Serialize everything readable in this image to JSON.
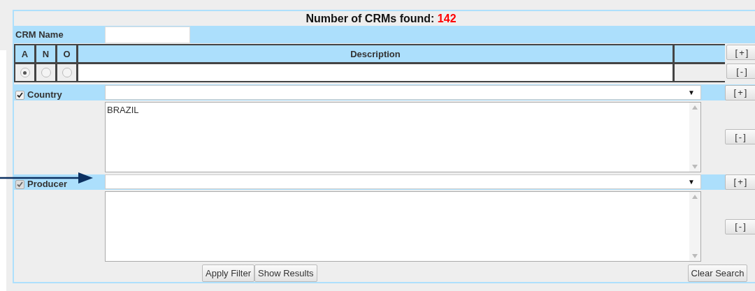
{
  "title": {
    "label": "Number of CRMs found:",
    "count": "142"
  },
  "crm_name": {
    "label": "CRM Name"
  },
  "table": {
    "columns": [
      "A",
      "N",
      "O",
      "Description"
    ],
    "add_button": "[+]",
    "remove_button": "[-]",
    "radios": [
      {
        "selected": true
      },
      {
        "selected": false
      },
      {
        "selected": false
      }
    ]
  },
  "filters": [
    {
      "label": "Country",
      "checked": true,
      "disabled": false,
      "dropdown_arrow": "▼",
      "list_items": [
        "BRAZIL"
      ],
      "add_button": "[+]",
      "remove_button": "[-]"
    },
    {
      "label": "Producer",
      "checked": true,
      "disabled": true,
      "dropdown_arrow": "▼",
      "add_button": "[+]",
      "remove_button": "[-]"
    }
  ],
  "buttons": [
    "Apply Filter",
    "Show Results"
  ],
  "clear_button": "Clear Search"
}
